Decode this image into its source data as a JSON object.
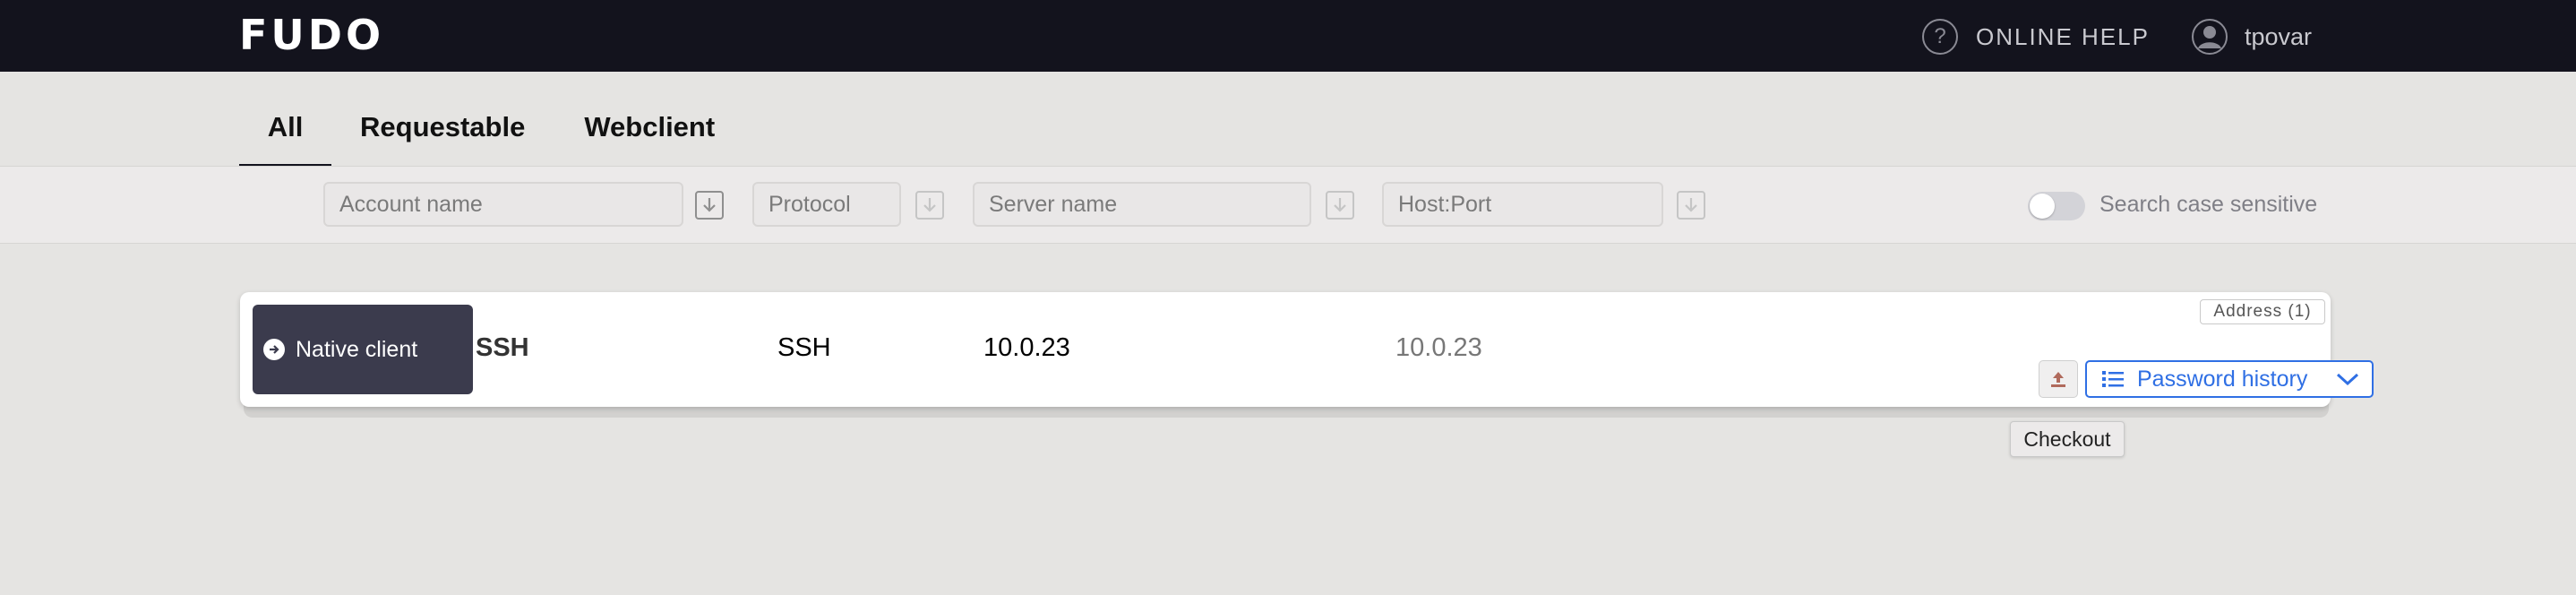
{
  "header": {
    "logo": "FUDO",
    "help_label": "ONLINE HELP",
    "help_icon": "?",
    "username": "tpovar"
  },
  "tabs": [
    {
      "label": "All",
      "active": true
    },
    {
      "label": "Requestable",
      "active": false
    },
    {
      "label": "Webclient",
      "active": false
    }
  ],
  "filters": {
    "account_placeholder": "Account name",
    "protocol_placeholder": "Protocol",
    "server_placeholder": "Server name",
    "host_placeholder": "Host:Port",
    "case_sensitive_label": "Search case sensitive",
    "case_sensitive_on": false
  },
  "row": {
    "connect_label": "Native client",
    "account": "SSH",
    "protocol": "SSH",
    "server": "10.0.23",
    "host": "10.0.23",
    "address_badge": "Address (1)",
    "password_history_label": "Password history",
    "checkout_tooltip": "Checkout"
  },
  "colors": {
    "topbar": "#13131d",
    "accent_blue": "#2f6fe4",
    "connect_button": "#3b3b4d"
  }
}
